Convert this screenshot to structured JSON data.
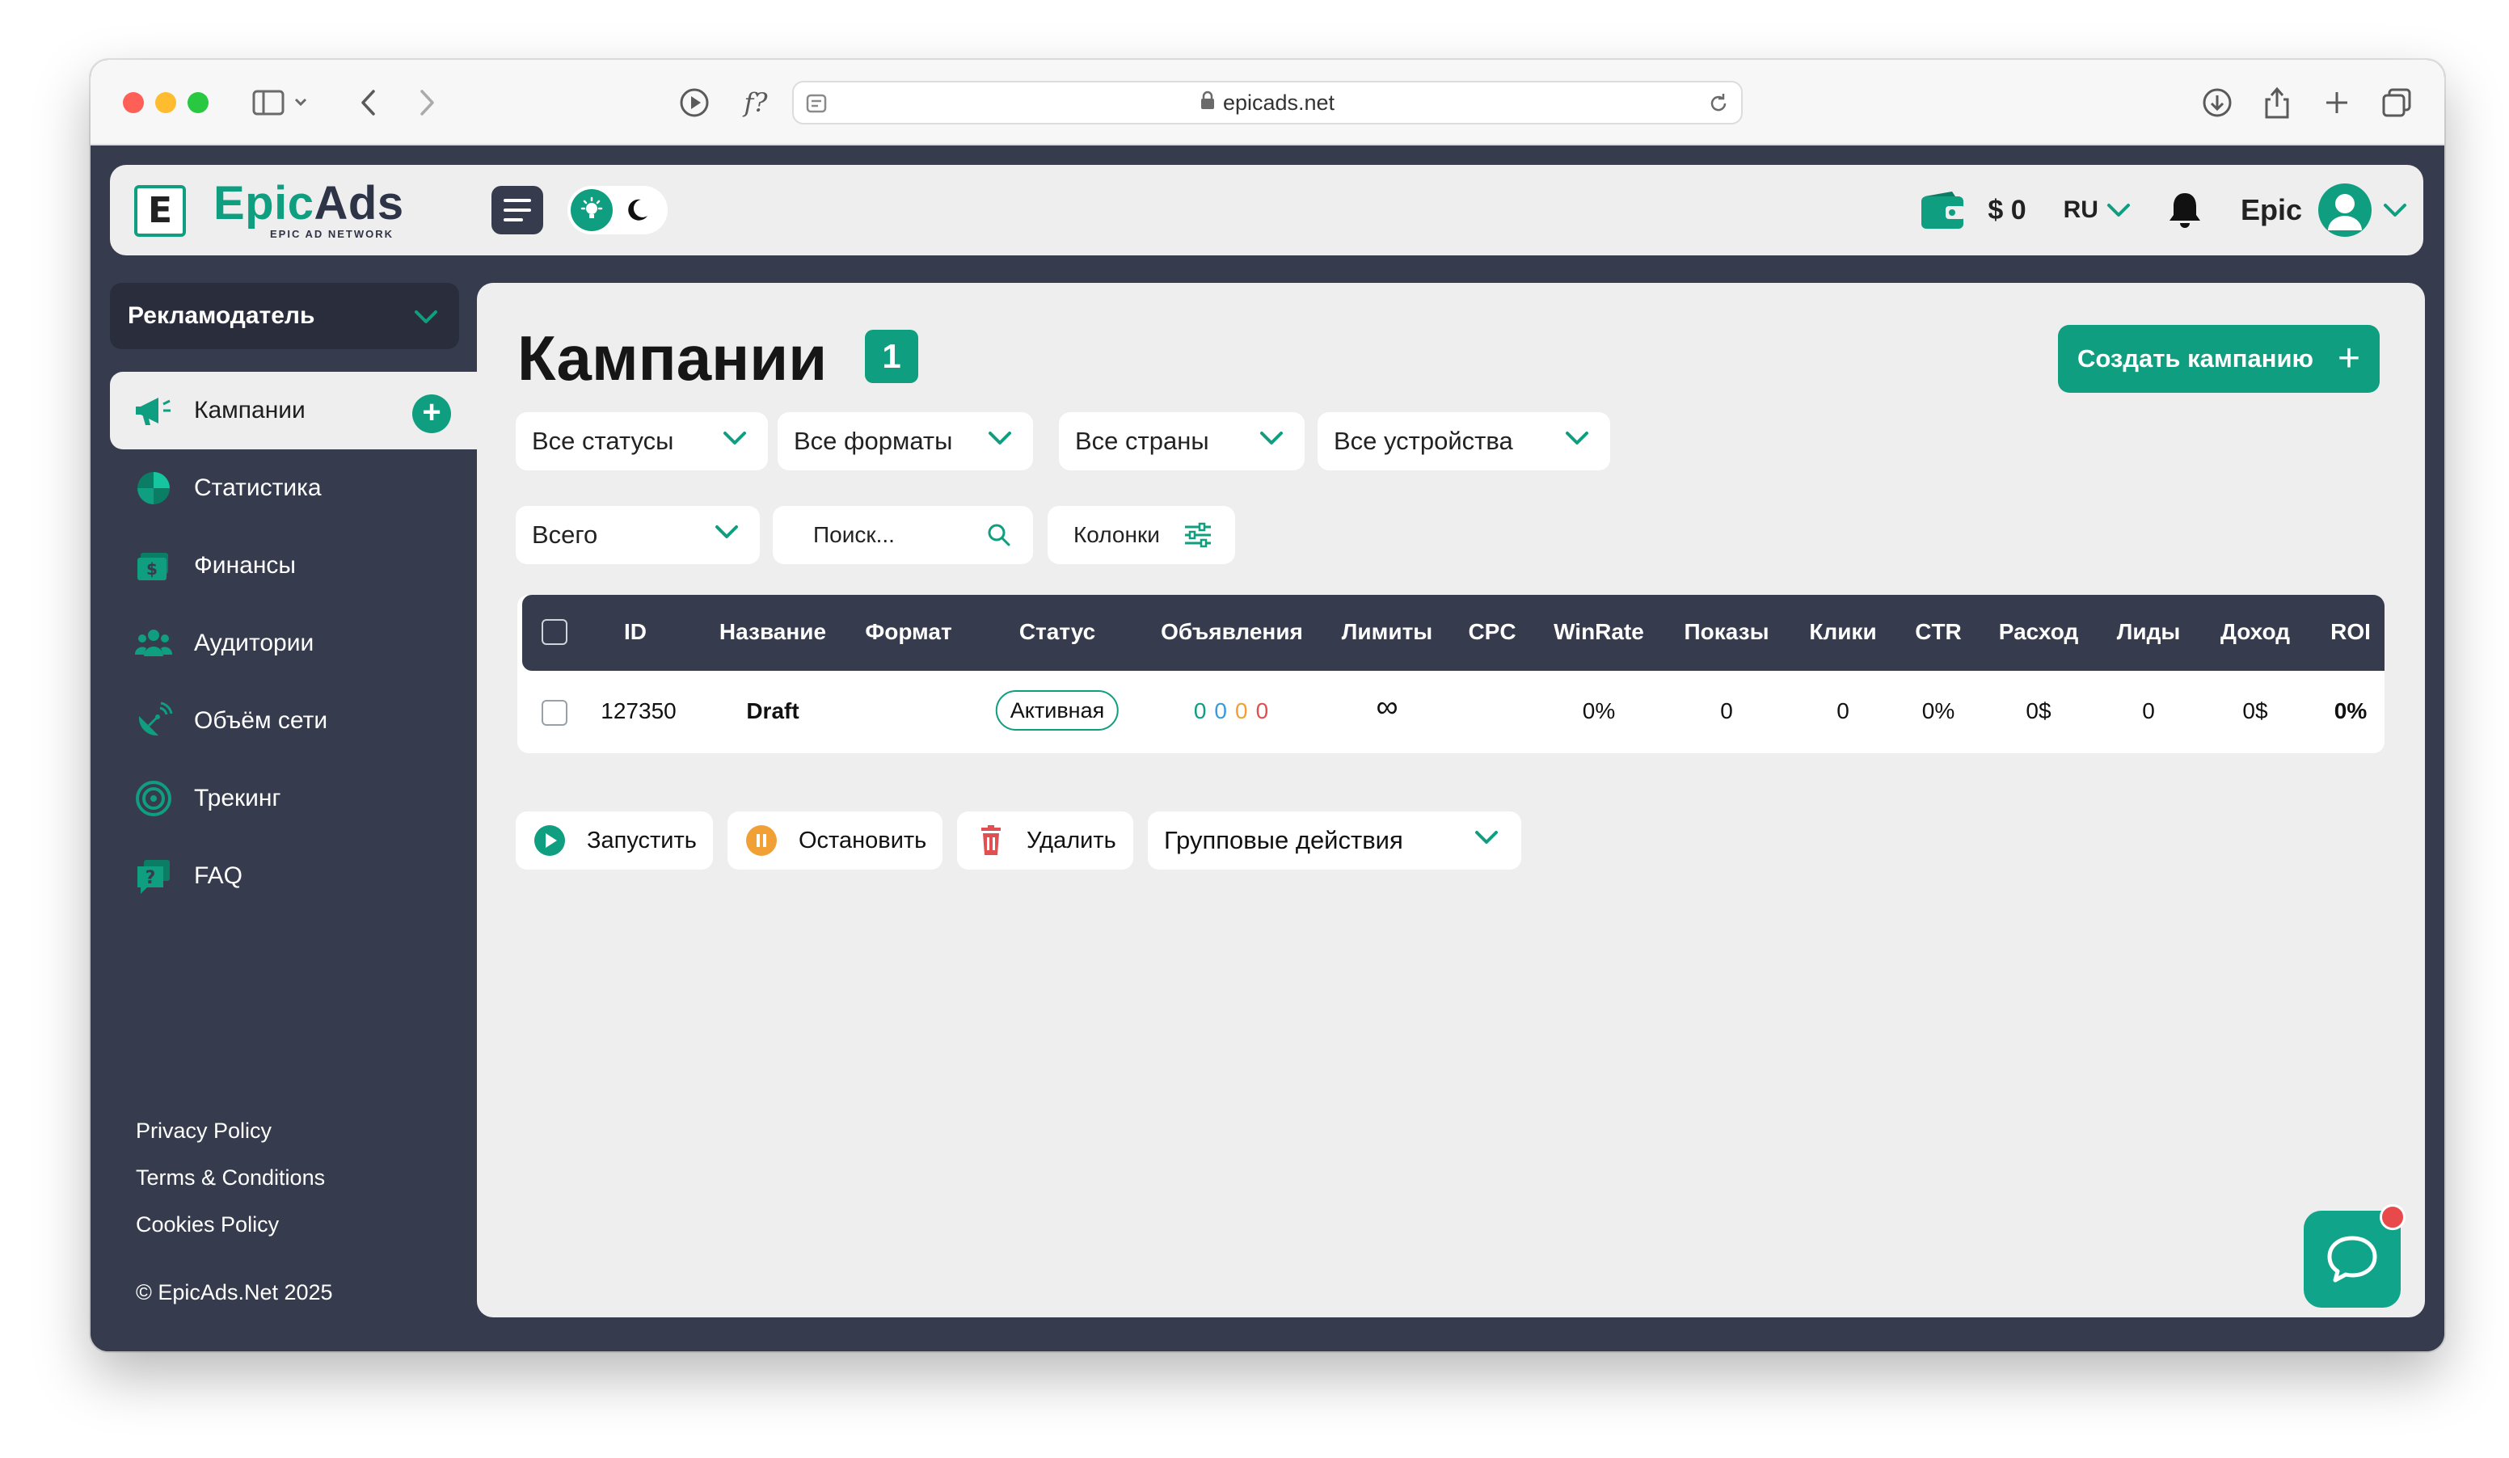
{
  "browser": {
    "url": "epicads.net"
  },
  "header": {
    "logo_name_part1": "Epic",
    "logo_name_part2": "Ads",
    "logo_tagline": "EPIC AD NETWORK",
    "logo_letter": "E",
    "balance": "$ 0",
    "language": "RU",
    "username": "Epic"
  },
  "sidebar": {
    "role": "Рекламодатель",
    "items": [
      {
        "label": "Кампании",
        "icon": "megaphone-icon",
        "active": true
      },
      {
        "label": "Статистика",
        "icon": "pie-chart-icon"
      },
      {
        "label": "Финансы",
        "icon": "money-icon"
      },
      {
        "label": "Аудитории",
        "icon": "users-icon"
      },
      {
        "label": "Объём сети",
        "icon": "satellite-icon"
      },
      {
        "label": "Трекинг",
        "icon": "target-icon"
      },
      {
        "label": "FAQ",
        "icon": "help-icon"
      }
    ],
    "footer_links": [
      "Privacy Policy",
      "Terms & Conditions",
      "Cookies Policy"
    ],
    "copyright": "© EpicAds.Net 2025"
  },
  "main": {
    "title": "Кампании",
    "count": "1",
    "create_button": "Создать кампанию",
    "filters": {
      "status": "Все статусы",
      "format": "Все форматы",
      "country": "Все страны",
      "device": "Все устройства",
      "period": "Всего",
      "search_placeholder": "Поиск...",
      "columns": "Колонки"
    },
    "table": {
      "headers": [
        "ID",
        "Название",
        "Формат",
        "Статус",
        "Объявления",
        "Лимиты",
        "CPC",
        "WinRate",
        "Показы",
        "Клики",
        "CTR",
        "Расход",
        "Лиды",
        "Доход",
        "ROI"
      ],
      "rows": [
        {
          "id": "127350",
          "name": "Draft",
          "format": "",
          "status": "Активная",
          "ads": [
            "0",
            "0",
            "0",
            "0"
          ],
          "limits": "∞",
          "cpc": "",
          "winrate": "0%",
          "impressions": "0",
          "clicks": "0",
          "ctr": "0%",
          "spend": "0$",
          "leads": "0",
          "income": "0$",
          "roi": "0%"
        }
      ]
    },
    "actions": {
      "start": "Запустить",
      "stop": "Остановить",
      "delete": "Удалить",
      "bulk": "Групповые действия"
    }
  },
  "colors": {
    "accent": "#0f9e7f",
    "sidebar_bg": "#363b4e",
    "content_bg": "#eeeeee",
    "stop_orange": "#f0a035",
    "delete_red": "#e05050",
    "notification_red": "#e8494a"
  }
}
